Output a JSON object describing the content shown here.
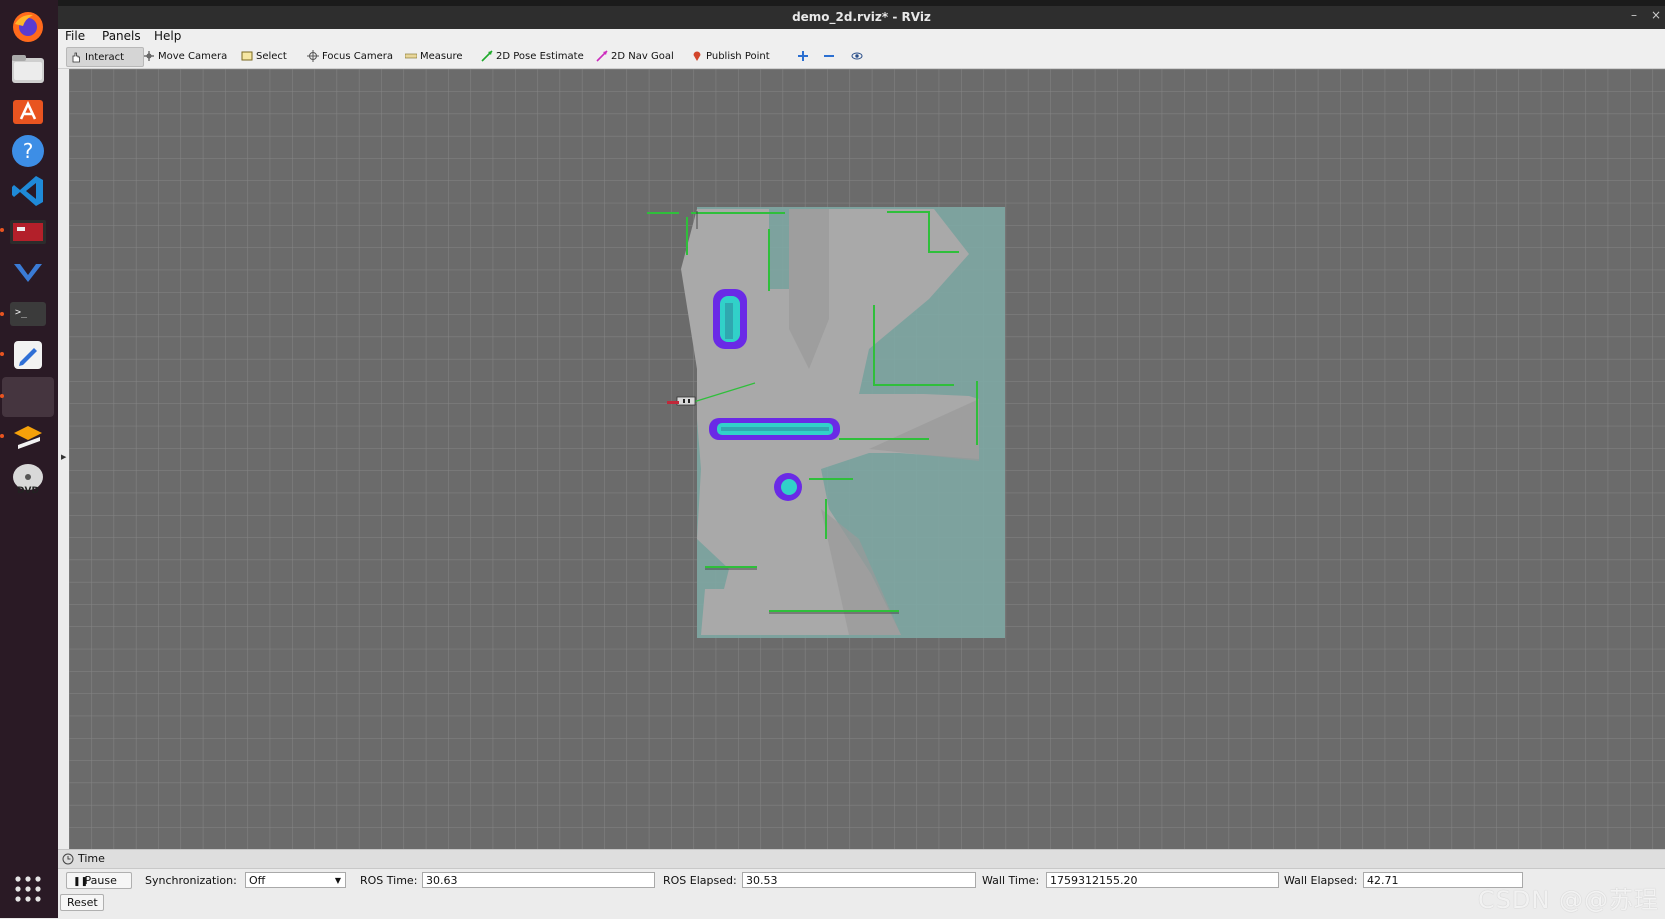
{
  "window": {
    "title": "demo_2d.rviz* - RViz",
    "min_glyph": "–",
    "close_glyph": "×"
  },
  "menu": {
    "file": "File",
    "panels": "Panels",
    "help": "Help"
  },
  "toolbar": {
    "interact": "Interact",
    "move_camera": "Move Camera",
    "select": "Select",
    "focus_camera": "Focus Camera",
    "measure": "Measure",
    "pose_estimate": "2D Pose Estimate",
    "nav_goal": "2D Nav Goal",
    "publish_point": "Publish Point"
  },
  "dock": {
    "items": [
      "firefox-icon",
      "files-icon",
      "software-store-icon",
      "help-icon",
      "vscode-icon",
      "rviz-terminal-icon",
      "vim-like-icon",
      "terminal-icon",
      "text-editor-icon",
      "active-app-slot",
      "layers-icon",
      "dvd-icon"
    ],
    "apps_grid": "show-apps-icon"
  },
  "time_panel": {
    "header": "Time",
    "pause_label": "Pause",
    "sync_label": "Synchronization:",
    "sync_value": "Off",
    "ros_time_label": "ROS Time:",
    "ros_time": "30.63",
    "ros_elapsed_label": "ROS Elapsed:",
    "ros_elapsed": "30.53",
    "wall_time_label": "Wall Time:",
    "wall_time": "1759312155.20",
    "wall_elapsed_label": "Wall Elapsed:",
    "wall_elapsed": "42.71",
    "reset_label": "Reset"
  },
  "watermark": "CSDN @@苏珵",
  "colors": {
    "grid_bg": "#6b6b6b",
    "grid_line": "#858585",
    "costmap": "#7fa7a3",
    "free_space": "#a9a9a9",
    "inflation_inner": "#31d1c9",
    "inflation_outer": "#6a2ae6",
    "obstacle_green": "#2fbf3b"
  }
}
